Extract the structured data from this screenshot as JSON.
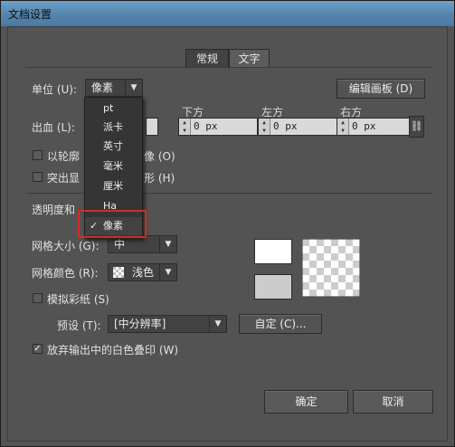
{
  "window": {
    "title": "文档设置"
  },
  "tabs": [
    {
      "label": "常规"
    },
    {
      "label": "文字"
    }
  ],
  "units": {
    "label": "单位 (U):",
    "value": "像素",
    "menu_items": [
      "pt",
      "派卡",
      "英寸",
      "毫米",
      "厘米",
      "Ha",
      "像素"
    ],
    "selected": "像素"
  },
  "edit_artboards_label": "编辑画板 (D)",
  "bleed": {
    "label": "出血 (L):",
    "columns": [
      {
        "label": "",
        "value": ""
      },
      {
        "label": "下方",
        "value": "0 px"
      },
      {
        "label": "左方",
        "value": "0 px"
      },
      {
        "label": "右方",
        "value": "0 px"
      }
    ]
  },
  "checkboxes": {
    "outline": {
      "label_a": "以轮廓",
      "label_b": "像 (O)",
      "checked": false
    },
    "highlight": {
      "label_a": "突出显",
      "label_b": "形 (H)",
      "checked": false
    },
    "simulate_paper": {
      "label": "模拟彩纸 (S)",
      "checked": false
    },
    "discard_white": {
      "label": "放弃输出中的白色叠印 (W)",
      "checked": true
    }
  },
  "transparency": {
    "section_label": "透明度和",
    "grid_size": {
      "label": "网格大小 (G):",
      "value": "中"
    },
    "grid_color": {
      "label": "网格颜色 (R):",
      "value": "浅色"
    },
    "preset": {
      "label": "预设 (T):",
      "value": "[中分辨率]"
    },
    "custom_label": "自定 (C)..."
  },
  "footer": {
    "ok_label": "确定",
    "cancel_label": "取消"
  }
}
